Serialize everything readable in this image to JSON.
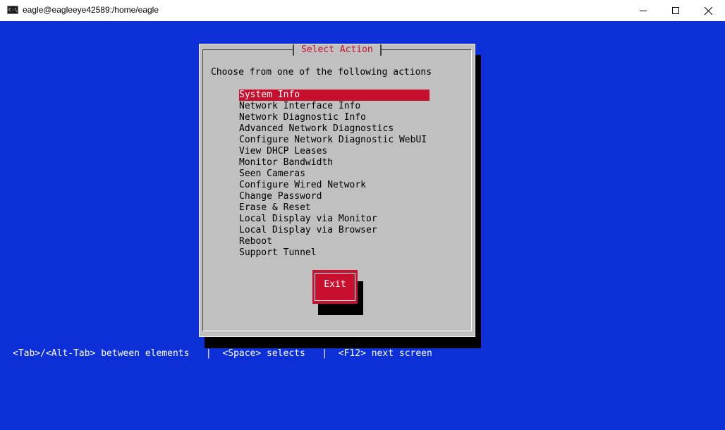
{
  "window": {
    "app_icon_text": "C:\\",
    "title": "eagle@eagleeye42589:/home/eagle"
  },
  "dialog": {
    "title": "Select Action",
    "prompt": "Choose from one of the following actions",
    "items": [
      {
        "label": "System Info",
        "selected": true
      },
      {
        "label": "Network Interface Info",
        "selected": false
      },
      {
        "label": "Network Diagnostic Info",
        "selected": false
      },
      {
        "label": "Advanced Network Diagnostics",
        "selected": false
      },
      {
        "label": "Configure Network Diagnostic WebUI",
        "selected": false
      },
      {
        "label": "View DHCP Leases",
        "selected": false
      },
      {
        "label": "Monitor Bandwidth",
        "selected": false
      },
      {
        "label": "Seen Cameras",
        "selected": false
      },
      {
        "label": "Configure Wired Network",
        "selected": false
      },
      {
        "label": "Change Password",
        "selected": false
      },
      {
        "label": "Erase & Reset",
        "selected": false
      },
      {
        "label": "Local Display via Monitor",
        "selected": false
      },
      {
        "label": "Local Display via Browser",
        "selected": false
      },
      {
        "label": "Reboot",
        "selected": false
      },
      {
        "label": "Support Tunnel",
        "selected": false
      }
    ],
    "exit_label": "Exit"
  },
  "help_bar": "<Tab>/<Alt-Tab> between elements   |  <Space> selects   |  <F12> next screen",
  "colors": {
    "terminal_background": "#0c2fd8",
    "dialog_background": "#c0c0c0",
    "accent": "#c8102e",
    "shadow": "#000000"
  },
  "icons": {
    "minimize": "minimize-icon",
    "maximize": "maximize-icon",
    "close": "close-icon",
    "app": "console-icon"
  }
}
